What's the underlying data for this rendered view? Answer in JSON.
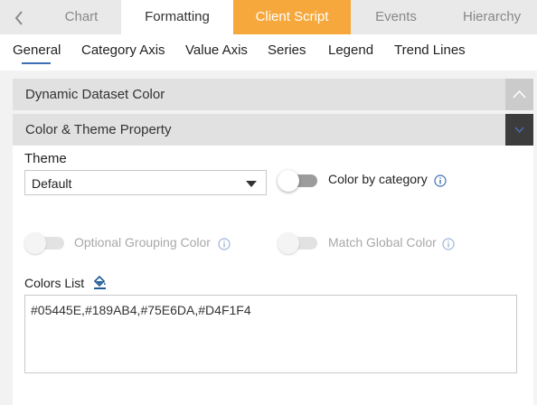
{
  "top_tabs": {
    "back_icon": "chevron-left-icon",
    "items": [
      "Chart",
      "Formatting",
      "Client Script",
      "Events",
      "Hierarchy"
    ],
    "active": "Formatting",
    "highlight_color": "#f6a83c"
  },
  "sub_tabs": {
    "items": [
      "General",
      "Category Axis",
      "Value Axis",
      "Series",
      "Legend",
      "Trend Lines"
    ],
    "active": "General",
    "underline_color": "#3d6fb6"
  },
  "sections": {
    "dynamic_dataset_color": {
      "title": "Dynamic Dataset Color",
      "icon": "chevron-up-icon"
    },
    "color_theme_property": {
      "title": "Color & Theme Property",
      "icon": "chevron-down-icon"
    }
  },
  "theme": {
    "label": "Theme",
    "value": "Default",
    "icon": "caret-down-icon"
  },
  "color_by_category": {
    "label": "Color by category",
    "enabled": false,
    "info_icon": "info-icon"
  },
  "optional_grouping_color": {
    "label": "Optional Grouping Color",
    "enabled": false,
    "disabled": true,
    "info_icon": "info-icon"
  },
  "match_global_color": {
    "label": "Match Global Color",
    "enabled": false,
    "disabled": true,
    "info_icon": "info-icon"
  },
  "colors_list": {
    "label": "Colors List",
    "icon": "paint-bucket-icon",
    "value": "#05445E,#189AB4,#75E6DA,#D4F1F4"
  }
}
